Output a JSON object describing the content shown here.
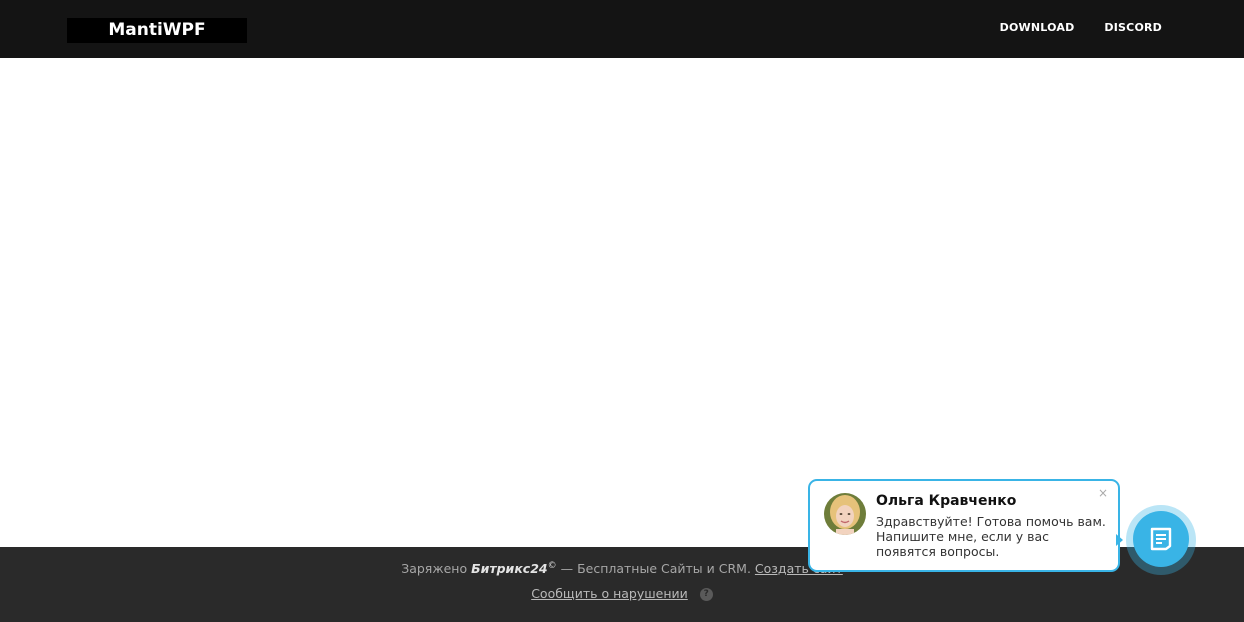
{
  "header": {
    "logo": "MantiWPF",
    "nav": [
      "DOWNLOAD",
      "DISCORD"
    ]
  },
  "footer": {
    "powered_prefix": "Заряжено",
    "brand": "Битрикс24",
    "brand_mark": "©",
    "tagline": "— Бесплатные Сайты и CRM.",
    "create_link": "Создать сайт",
    "report_link": "Сообщить о нарушении",
    "help_glyph": "?"
  },
  "chat": {
    "agent_name": "Ольга Кравченко",
    "message": "Здравствуйте! Готова помочь вам. Напишите мне, если у вас появятся вопросы.",
    "close_glyph": "×",
    "icon": "chat-icon"
  },
  "colors": {
    "header_bg": "#141414",
    "footer_bg": "#2a2a2a",
    "accent": "#39b4e6"
  }
}
